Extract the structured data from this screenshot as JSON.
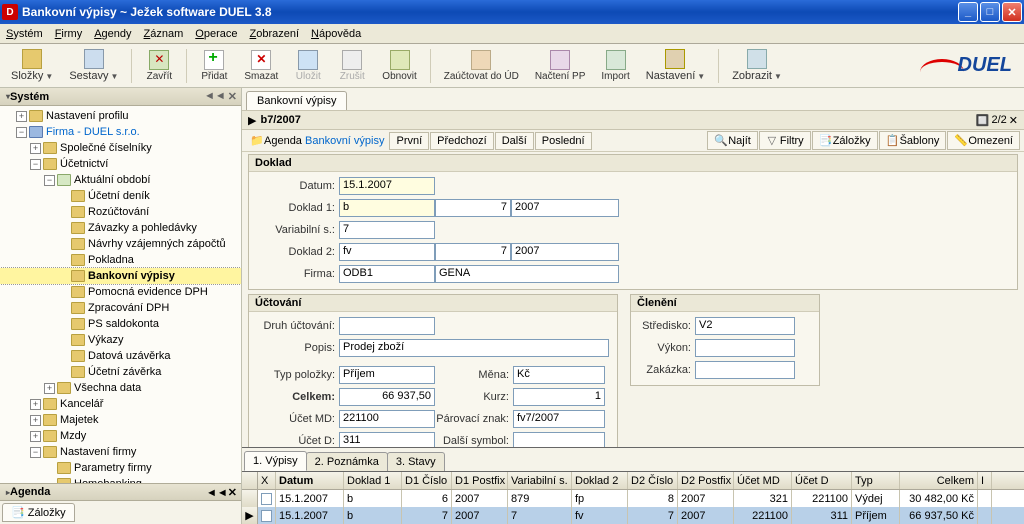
{
  "window": {
    "title": "Bankovní výpisy ~ Ježek software DUEL 3.8",
    "app_icon_letter": "D"
  },
  "menu": {
    "items": [
      "Systém",
      "Firmy",
      "Agendy",
      "Záznam",
      "Operace",
      "Zobrazení",
      "Nápověda"
    ]
  },
  "toolbar": {
    "slozky": "Složky",
    "sestavy": "Sestavy",
    "zavrit": "Zavřít",
    "pridat": "Přidat",
    "smazat": "Smazat",
    "ulozit": "Uložit",
    "zrusit": "Zrušit",
    "obnovit": "Obnovit",
    "zauctovat": "Zaúčtovat do ÚD",
    "nactenipp": "Načtení PP",
    "import": "Import",
    "nastaveni": "Nastavení",
    "zobrazit": "Zobrazit"
  },
  "logo": "DUEL",
  "leftpanel": {
    "hdr": "Systém",
    "tree": {
      "nastaveni_profilu": "Nastavení profilu",
      "firma": "Firma - DUEL s.r.o.",
      "spolecne": "Společné číselníky",
      "ucetnictvi": "Účetnictví",
      "aktualni": "Aktuální období",
      "denik": "Účetní deník",
      "rozuctovani": "Rozúčtování",
      "zavazky": "Závazky a pohledávky",
      "navrhy": "Návrhy vzájemných zápočtů",
      "pokladna": "Pokladna",
      "bankovni": "Bankovní výpisy",
      "pomocna": "Pomocná evidence DPH",
      "zpracovani": "Zpracování DPH",
      "saldokonta": "PS saldokonta",
      "vykazy": "Výkazy",
      "datova": "Datová uzávěrka",
      "ucetni_zav": "Účetní závěrka",
      "vsechna": "Všechna data",
      "kancelar": "Kancelář",
      "majetek": "Majetek",
      "mzdy": "Mzdy",
      "nastaveni_firmy": "Nastavení firmy",
      "parametry": "Parametry firmy",
      "homebanking": "Homebanking"
    },
    "hdr2": "Agenda",
    "tab": "Záložky"
  },
  "doc": {
    "tab": "Bankovní výpisy",
    "breadcrumb": "b7/2007",
    "counter": "2/2",
    "bar": {
      "agenda_lbl": "Agenda",
      "agenda": "Bankovní výpisy",
      "prvni": "První",
      "predchozi": "Předchozí",
      "dalsi": "Další",
      "posledni": "Poslední",
      "najit": "Najít",
      "filtry": "Filtry",
      "zalozky": "Záložky",
      "sablony": "Šablony",
      "omezeni": "Omezení"
    },
    "doklad": {
      "title": "Doklad",
      "datum_lbl": "Datum:",
      "datum": "15.1.2007",
      "doklad1_lbl": "Doklad 1:",
      "doklad1_a": "b",
      "doklad1_b": "7",
      "doklad1_c": "2007",
      "vs_lbl": "Variabilní s.:",
      "vs": "7",
      "doklad2_lbl": "Doklad 2:",
      "doklad2_a": "fv",
      "doklad2_b": "7",
      "doklad2_c": "2007",
      "firma_lbl": "Firma:",
      "firma_a": "ODB1",
      "firma_b": "GENA"
    },
    "uctovani": {
      "title": "Účtování",
      "druh_lbl": "Druh účtování:",
      "druh": "",
      "popis_lbl": "Popis:",
      "popis": "Prodej zboží",
      "typ_lbl": "Typ položky:",
      "typ": "Příjem",
      "mena_lbl": "Měna:",
      "mena": "Kč",
      "celkem_lbl": "Celkem:",
      "celkem": "66 937,50",
      "kurz_lbl": "Kurz:",
      "kurz": "1",
      "ucetmd_lbl": "Účet MD:",
      "ucetmd": "221100",
      "parznak_lbl": "Párovací znak:",
      "parznak": "fv7/2007",
      "ucetd_lbl": "Účet D:",
      "ucetd": "311",
      "dalsi_lbl": "Další symbol:",
      "dalsi": ""
    },
    "cleneni": {
      "title": "Členění",
      "stredisko_lbl": "Středisko:",
      "stredisko": "V2",
      "vykon_lbl": "Výkon:",
      "vykon": "",
      "zakazka_lbl": "Zakázka:",
      "zakazka": ""
    },
    "btabs": {
      "t1": "1. Výpisy",
      "t2": "2. Poznámka",
      "t3": "3. Stavy"
    },
    "grid": {
      "cols": [
        "X",
        "Datum",
        "Doklad 1",
        "D1 Číslo",
        "D1 Postfix",
        "Variabilní s.",
        "Doklad 2",
        "D2 Číslo",
        "D2 Postfix",
        "Účet MD",
        "Účet D",
        "Typ",
        "Celkem",
        "I"
      ],
      "rows": [
        {
          "datum": "15.1.2007",
          "d1": "b",
          "d1c": "6",
          "d1p": "2007",
          "vs": "879",
          "d2": "fp",
          "d2c": "8",
          "d2p": "2007",
          "md": "321",
          "d": "221100",
          "typ": "Výdej",
          "celkem": "30 482,00 Kč"
        },
        {
          "datum": "15.1.2007",
          "d1": "b",
          "d1c": "7",
          "d1p": "2007",
          "vs": "7",
          "d2": "fv",
          "d2c": "7",
          "d2p": "2007",
          "md": "221100",
          "d": "311",
          "typ": "Příjem",
          "celkem": "66 937,50 Kč"
        }
      ]
    }
  }
}
